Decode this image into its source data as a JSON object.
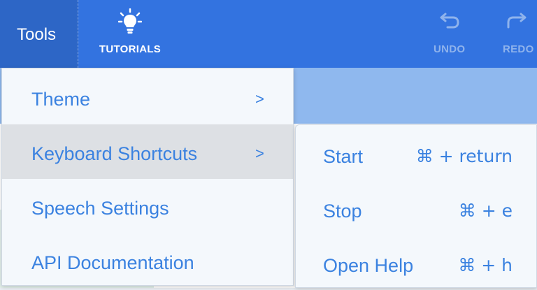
{
  "toolbar": {
    "tools_label": "Tools",
    "tutorials_label": "TUTORIALS",
    "undo_label": "UNDO",
    "redo_label": "REDO",
    "icons": {
      "tutorials": "lightbulb-icon",
      "undo": "undo-icon",
      "redo": "redo-icon"
    }
  },
  "menu": {
    "items": [
      {
        "label": "Theme",
        "arrow": ">"
      },
      {
        "label": "Keyboard Shortcuts",
        "arrow": ">"
      },
      {
        "label": "Speech Settings"
      },
      {
        "label": "API Documentation"
      }
    ]
  },
  "submenu": {
    "items": [
      {
        "label": "Start",
        "shortcut": "⌘ + return"
      },
      {
        "label": "Stop",
        "shortcut": "⌘ + e"
      },
      {
        "label": "Open Help",
        "shortcut": "⌘ + h"
      }
    ]
  },
  "colors": {
    "toolbar": "#3373e0",
    "menu_text": "#3b82e0",
    "menu_bg": "#f4f8fc",
    "highlight": "#dde0e4"
  }
}
